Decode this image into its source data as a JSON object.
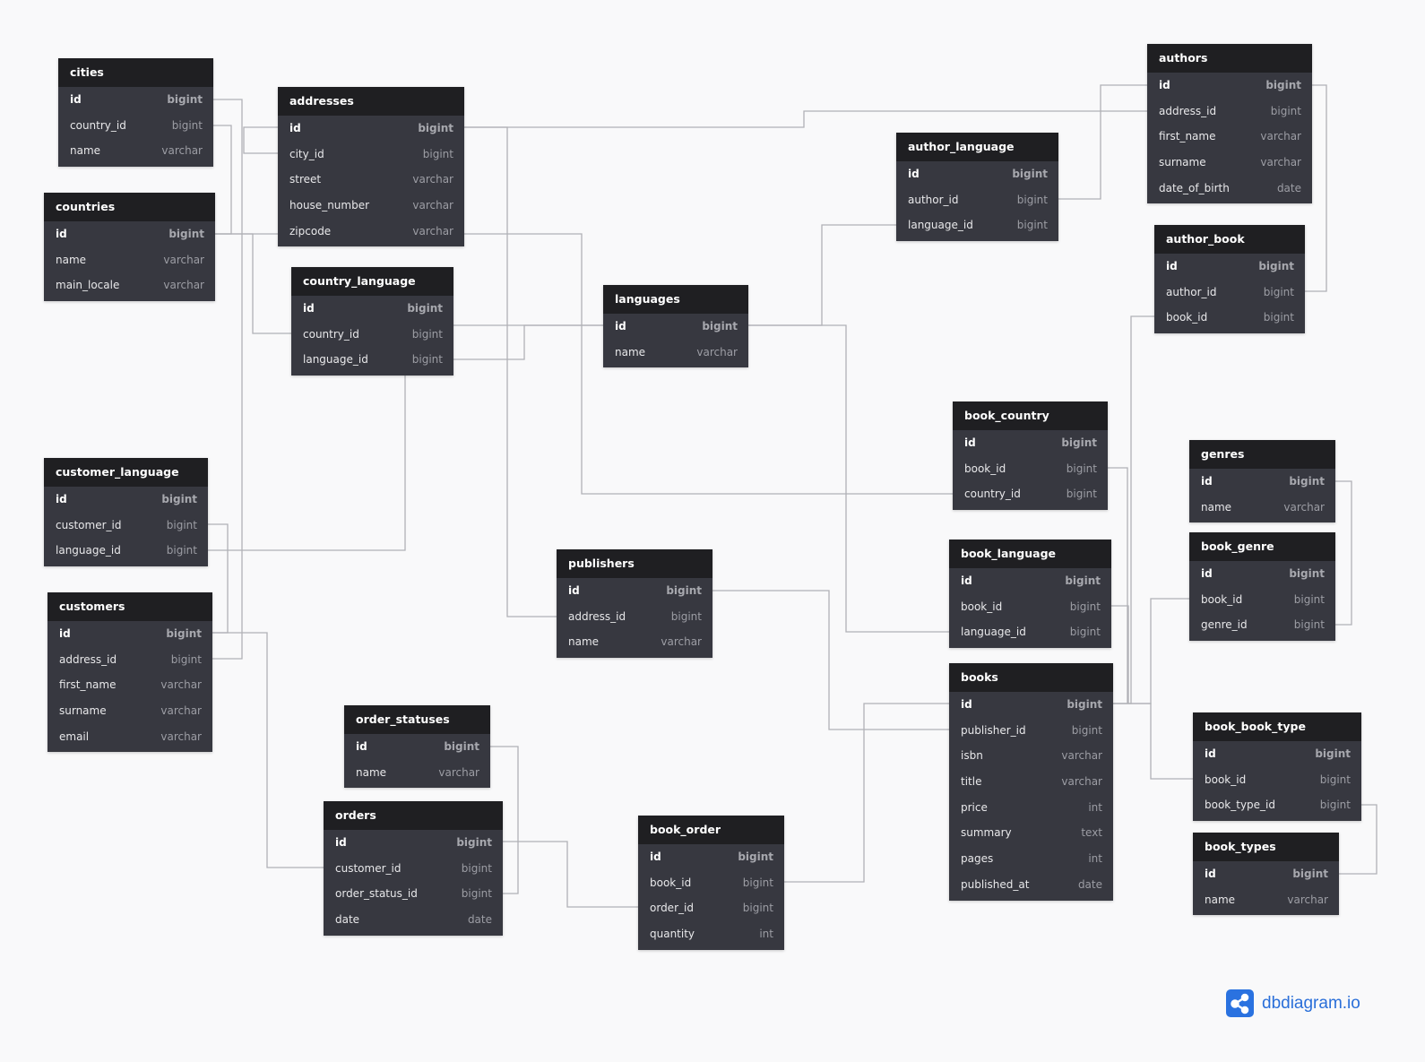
{
  "brand": {
    "name": "dbdiagram.io",
    "accent": "#2a72e0"
  },
  "colors": {
    "header": "#1f1f22",
    "body": "#373840",
    "connector": "#b0b1b6"
  },
  "tables": [
    {
      "name": "cities",
      "columns": [
        {
          "name": "id",
          "type": "bigint"
        },
        {
          "name": "country_id",
          "type": "bigint"
        },
        {
          "name": "name",
          "type": "varchar"
        }
      ]
    },
    {
      "name": "addresses",
      "columns": [
        {
          "name": "id",
          "type": "bigint"
        },
        {
          "name": "city_id",
          "type": "bigint"
        },
        {
          "name": "street",
          "type": "varchar"
        },
        {
          "name": "house_number",
          "type": "varchar"
        },
        {
          "name": "zipcode",
          "type": "varchar"
        }
      ]
    },
    {
      "name": "countries",
      "columns": [
        {
          "name": "id",
          "type": "bigint"
        },
        {
          "name": "name",
          "type": "varchar"
        },
        {
          "name": "main_locale",
          "type": "varchar"
        }
      ]
    },
    {
      "name": "country_language",
      "columns": [
        {
          "name": "id",
          "type": "bigint"
        },
        {
          "name": "country_id",
          "type": "bigint"
        },
        {
          "name": "language_id",
          "type": "bigint"
        }
      ]
    },
    {
      "name": "languages",
      "columns": [
        {
          "name": "id",
          "type": "bigint"
        },
        {
          "name": "name",
          "type": "varchar"
        }
      ]
    },
    {
      "name": "author_language",
      "columns": [
        {
          "name": "id",
          "type": "bigint"
        },
        {
          "name": "author_id",
          "type": "bigint"
        },
        {
          "name": "language_id",
          "type": "bigint"
        }
      ]
    },
    {
      "name": "authors",
      "columns": [
        {
          "name": "id",
          "type": "bigint"
        },
        {
          "name": "address_id",
          "type": "bigint"
        },
        {
          "name": "first_name",
          "type": "varchar"
        },
        {
          "name": "surname",
          "type": "varchar"
        },
        {
          "name": "date_of_birth",
          "type": "date"
        }
      ]
    },
    {
      "name": "author_book",
      "columns": [
        {
          "name": "id",
          "type": "bigint"
        },
        {
          "name": "author_id",
          "type": "bigint"
        },
        {
          "name": "book_id",
          "type": "bigint"
        }
      ]
    },
    {
      "name": "book_country",
      "columns": [
        {
          "name": "id",
          "type": "bigint"
        },
        {
          "name": "book_id",
          "type": "bigint"
        },
        {
          "name": "country_id",
          "type": "bigint"
        }
      ]
    },
    {
      "name": "genres",
      "columns": [
        {
          "name": "id",
          "type": "bigint"
        },
        {
          "name": "name",
          "type": "varchar"
        }
      ]
    },
    {
      "name": "book_genre",
      "columns": [
        {
          "name": "id",
          "type": "bigint"
        },
        {
          "name": "book_id",
          "type": "bigint"
        },
        {
          "name": "genre_id",
          "type": "bigint"
        }
      ]
    },
    {
      "name": "book_language",
      "columns": [
        {
          "name": "id",
          "type": "bigint"
        },
        {
          "name": "book_id",
          "type": "bigint"
        },
        {
          "name": "language_id",
          "type": "bigint"
        }
      ]
    },
    {
      "name": "customer_language",
      "columns": [
        {
          "name": "id",
          "type": "bigint"
        },
        {
          "name": "customer_id",
          "type": "bigint"
        },
        {
          "name": "language_id",
          "type": "bigint"
        }
      ]
    },
    {
      "name": "publishers",
      "columns": [
        {
          "name": "id",
          "type": "bigint"
        },
        {
          "name": "address_id",
          "type": "bigint"
        },
        {
          "name": "name",
          "type": "varchar"
        }
      ]
    },
    {
      "name": "customers",
      "columns": [
        {
          "name": "id",
          "type": "bigint"
        },
        {
          "name": "address_id",
          "type": "bigint"
        },
        {
          "name": "first_name",
          "type": "varchar"
        },
        {
          "name": "surname",
          "type": "varchar"
        },
        {
          "name": "email",
          "type": "varchar"
        }
      ]
    },
    {
      "name": "books",
      "columns": [
        {
          "name": "id",
          "type": "bigint"
        },
        {
          "name": "publisher_id",
          "type": "bigint"
        },
        {
          "name": "isbn",
          "type": "varchar"
        },
        {
          "name": "title",
          "type": "varchar"
        },
        {
          "name": "price",
          "type": "int"
        },
        {
          "name": "summary",
          "type": "text"
        },
        {
          "name": "pages",
          "type": "int"
        },
        {
          "name": "published_at",
          "type": "date"
        }
      ]
    },
    {
      "name": "order_statuses",
      "columns": [
        {
          "name": "id",
          "type": "bigint"
        },
        {
          "name": "name",
          "type": "varchar"
        }
      ]
    },
    {
      "name": "orders",
      "columns": [
        {
          "name": "id",
          "type": "bigint"
        },
        {
          "name": "customer_id",
          "type": "bigint"
        },
        {
          "name": "order_status_id",
          "type": "bigint"
        },
        {
          "name": "date",
          "type": "date"
        }
      ]
    },
    {
      "name": "book_order",
      "columns": [
        {
          "name": "id",
          "type": "bigint"
        },
        {
          "name": "book_id",
          "type": "bigint"
        },
        {
          "name": "order_id",
          "type": "bigint"
        },
        {
          "name": "quantity",
          "type": "int"
        }
      ]
    },
    {
      "name": "book_book_type",
      "columns": [
        {
          "name": "id",
          "type": "bigint"
        },
        {
          "name": "book_id",
          "type": "bigint"
        },
        {
          "name": "book_type_id",
          "type": "bigint"
        }
      ]
    },
    {
      "name": "book_types",
      "columns": [
        {
          "name": "id",
          "type": "bigint"
        },
        {
          "name": "name",
          "type": "varchar"
        }
      ]
    }
  ]
}
